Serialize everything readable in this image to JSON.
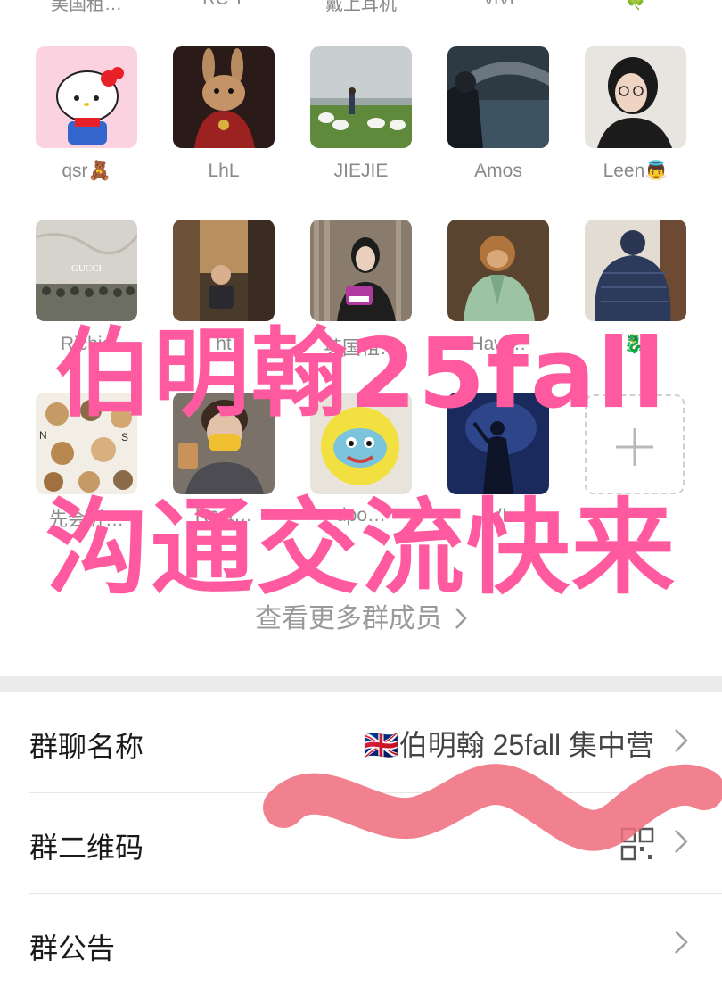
{
  "top_row_names": [
    "美国租…",
    "RC Y",
    "戴上耳机",
    "ViVi",
    "🍀"
  ],
  "members_row1": [
    {
      "name": "qsr🧸",
      "avatar": "hello-kitty-avatar"
    },
    {
      "name": "LhL",
      "avatar": "rabbit-warrior-avatar"
    },
    {
      "name": "JIEJIE",
      "avatar": "goats-field-avatar"
    },
    {
      "name": "Amos",
      "avatar": "river-bridge-avatar"
    },
    {
      "name": "Leen👼",
      "avatar": "woman-glasses-avatar"
    }
  ],
  "members_row2": [
    {
      "name": "Richie",
      "avatar": "gucci-soldiers-avatar"
    },
    {
      "name": "ht",
      "avatar": "child-alley-avatar"
    },
    {
      "name": "英国租…",
      "avatar": "woman-badge-avatar"
    },
    {
      "name": "Haw…",
      "avatar": "monkey-robe-avatar"
    },
    {
      "name": "🐉",
      "avatar": "gorilla-statue-avatar"
    }
  ],
  "members_row3": [
    {
      "name": "先会沂…",
      "avatar": "dogs-collage-avatar"
    },
    {
      "name": "Rest…",
      "avatar": "boy-mask-avatar"
    },
    {
      "name": "dpo…",
      "avatar": "yellow-plush-avatar"
    },
    {
      "name": "VI",
      "avatar": "concert-singer-avatar"
    }
  ],
  "add_member_icon": "plus-icon",
  "view_more": "查看更多群成员",
  "settings": {
    "group_name_label": "群聊名称",
    "group_name_value": "🇬🇧伯明翰 25fall 集中营",
    "qr_label": "群二维码",
    "notice_label": "群公告"
  },
  "overlay": {
    "line1": "伯明翰25fall",
    "line2": "沟通交流快来"
  },
  "colors": {
    "overlay_pink": "#ff5aa0",
    "scribble_red": "#f07080",
    "separator": "#ececec"
  }
}
